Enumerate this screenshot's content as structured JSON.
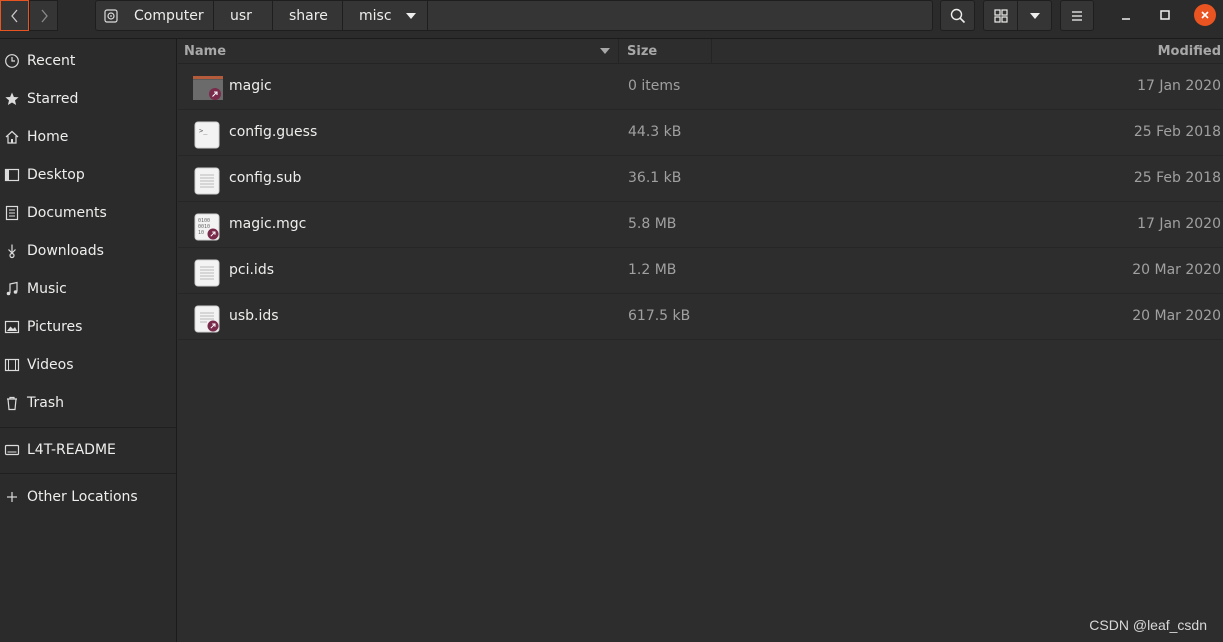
{
  "header": {
    "path": [
      {
        "label": "Computer",
        "icon": "disk-icon"
      },
      {
        "label": "usr"
      },
      {
        "label": "share"
      },
      {
        "label": "misc",
        "icon": "chevron-down-icon"
      }
    ]
  },
  "sidebar": {
    "items": [
      {
        "label": "Recent",
        "icon": "clock-icon"
      },
      {
        "label": "Starred",
        "icon": "star-icon"
      },
      {
        "label": "Home",
        "icon": "home-icon"
      },
      {
        "label": "Desktop",
        "icon": "desktop-icon"
      },
      {
        "label": "Documents",
        "icon": "document-icon"
      },
      {
        "label": "Downloads",
        "icon": "download-icon"
      },
      {
        "label": "Music",
        "icon": "music-icon"
      },
      {
        "label": "Pictures",
        "icon": "picture-icon"
      },
      {
        "label": "Videos",
        "icon": "video-icon"
      },
      {
        "label": "Trash",
        "icon": "trash-icon"
      }
    ],
    "devices": [
      {
        "label": "L4T-README",
        "icon": "drive-icon"
      }
    ],
    "other": {
      "label": "Other Locations",
      "icon": "plus-icon"
    }
  },
  "columns": {
    "name": "Name",
    "size": "Size",
    "modified": "Modified"
  },
  "files": [
    {
      "name": "magic",
      "size": "0 items",
      "modified": "17 Jan 2020",
      "type": "folder-link"
    },
    {
      "name": "config.guess",
      "size": "44.3 kB",
      "modified": "25 Feb 2018",
      "type": "script"
    },
    {
      "name": "config.sub",
      "size": "36.1 kB",
      "modified": "25 Feb 2018",
      "type": "text"
    },
    {
      "name": "magic.mgc",
      "size": "5.8 MB",
      "modified": "17 Jan 2020",
      "type": "binary-link"
    },
    {
      "name": "pci.ids",
      "size": "1.2 MB",
      "modified": "20 Mar 2020",
      "type": "text"
    },
    {
      "name": "usb.ids",
      "size": "617.5 kB",
      "modified": "20 Mar 2020",
      "type": "text-link"
    }
  ],
  "colors": {
    "accent": "#e95420",
    "link_badge": "#7a2a4a"
  },
  "watermark": "CSDN @leaf_csdn"
}
